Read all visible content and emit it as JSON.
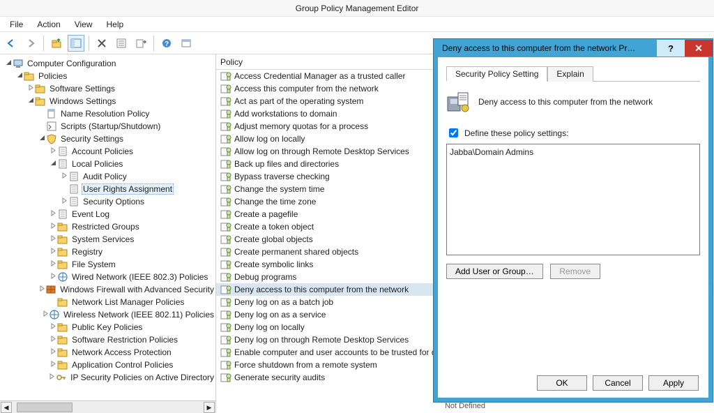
{
  "window": {
    "title": "Group Policy Management Editor"
  },
  "menu": {
    "file": "File",
    "action": "Action",
    "view": "View",
    "help": "Help"
  },
  "tree": {
    "root": "Computer Configuration",
    "policies": "Policies",
    "software": "Software Settings",
    "windows": "Windows Settings",
    "nrp": "Name Resolution Policy",
    "scripts": "Scripts (Startup/Shutdown)",
    "security": "Security Settings",
    "account": "Account Policies",
    "local": "Local Policies",
    "audit": "Audit Policy",
    "ura": "User Rights Assignment",
    "secopt": "Security Options",
    "eventlog": "Event Log",
    "restricted": "Restricted Groups",
    "services": "System Services",
    "registry": "Registry",
    "filesystem": "File System",
    "wired": "Wired Network (IEEE 802.3) Policies",
    "wfw": "Windows Firewall with Advanced Security",
    "nlist": "Network List Manager Policies",
    "wireless": "Wireless Network (IEEE 802.11) Policies",
    "pkey": "Public Key Policies",
    "srp": "Software Restriction Policies",
    "nap": "Network Access Protection",
    "appctl": "Application Control Policies",
    "ipsec": "IP Security Policies on Active Directory"
  },
  "list": {
    "header": "Policy",
    "items": [
      "Access Credential Manager as a trusted caller",
      "Access this computer from the network",
      "Act as part of the operating system",
      "Add workstations to domain",
      "Adjust memory quotas for a process",
      "Allow log on locally",
      "Allow log on through Remote Desktop Services",
      "Back up files and directories",
      "Bypass traverse checking",
      "Change the system time",
      "Change the time zone",
      "Create a pagefile",
      "Create a token object",
      "Create global objects",
      "Create permanent shared objects",
      "Create symbolic links",
      "Debug programs",
      "Deny access to this computer from the network",
      "Deny log on as a batch job",
      "Deny log on as a service",
      "Deny log on locally",
      "Deny log on through Remote Desktop Services",
      "Enable computer and user accounts to be trusted for delegation",
      "Force shutdown from a remote system",
      "Generate security audits"
    ],
    "selected_index": 17,
    "footer": "Not Defined"
  },
  "dialog": {
    "title": "Deny access to this computer from the network Pr…",
    "tab1": "Security Policy Setting",
    "tab2": "Explain",
    "policy_label": "Deny access to this computer from the network",
    "define_label": "Define these policy settings:",
    "define_checked": true,
    "entries": [
      "Jabba\\Domain Admins"
    ],
    "add_btn": "Add User or Group…",
    "remove_btn": "Remove",
    "ok": "OK",
    "cancel": "Cancel",
    "apply": "Apply"
  }
}
